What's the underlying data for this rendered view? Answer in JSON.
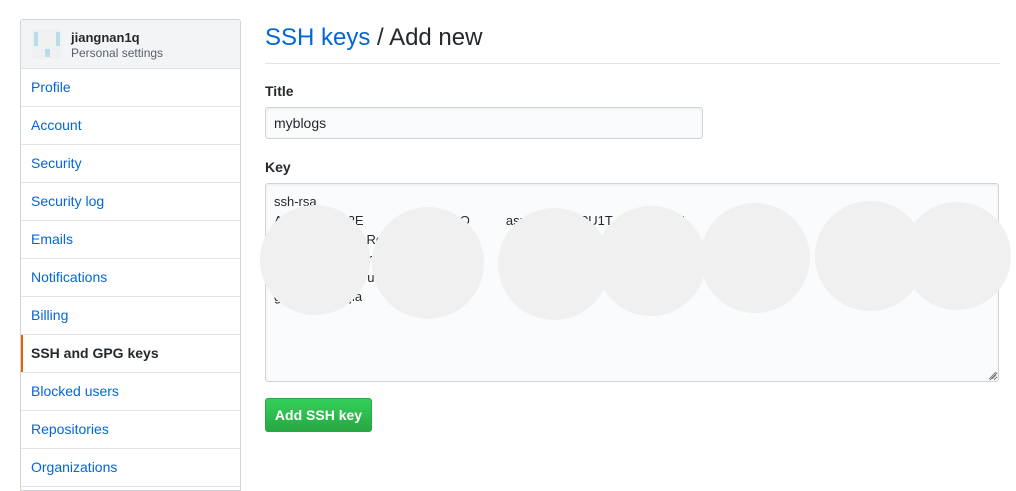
{
  "sidebar": {
    "username": "jiangnan1q",
    "subtitle": "Personal settings",
    "items": [
      {
        "label": "Profile"
      },
      {
        "label": "Account"
      },
      {
        "label": "Security"
      },
      {
        "label": "Security log"
      },
      {
        "label": "Emails"
      },
      {
        "label": "Notifications"
      },
      {
        "label": "Billing"
      },
      {
        "label": "SSH and GPG keys",
        "selected": true
      },
      {
        "label": "Blocked users"
      },
      {
        "label": "Repositories"
      },
      {
        "label": "Organizations"
      }
    ]
  },
  "header": {
    "breadcrumb_link": "SSH keys",
    "separator": " / ",
    "title": "Add new"
  },
  "form": {
    "title_label": "Title",
    "title_value": "myblogs",
    "key_label": "Key",
    "key_value": "ssh-rsa\nA          C1yc2E          ABAAABAQ          asnR9          PU1T          xKrgN          A\n          wf          eReE          K1\n          h          oLr          zt\n          LfG          utKJ/          Yw3\ng          .com:jia          angnan1q",
    "submit_label": "Add SSH key"
  },
  "colors": {
    "link": "#0366d6",
    "selected_accent": "#e36209",
    "button_green": "#28a745"
  }
}
